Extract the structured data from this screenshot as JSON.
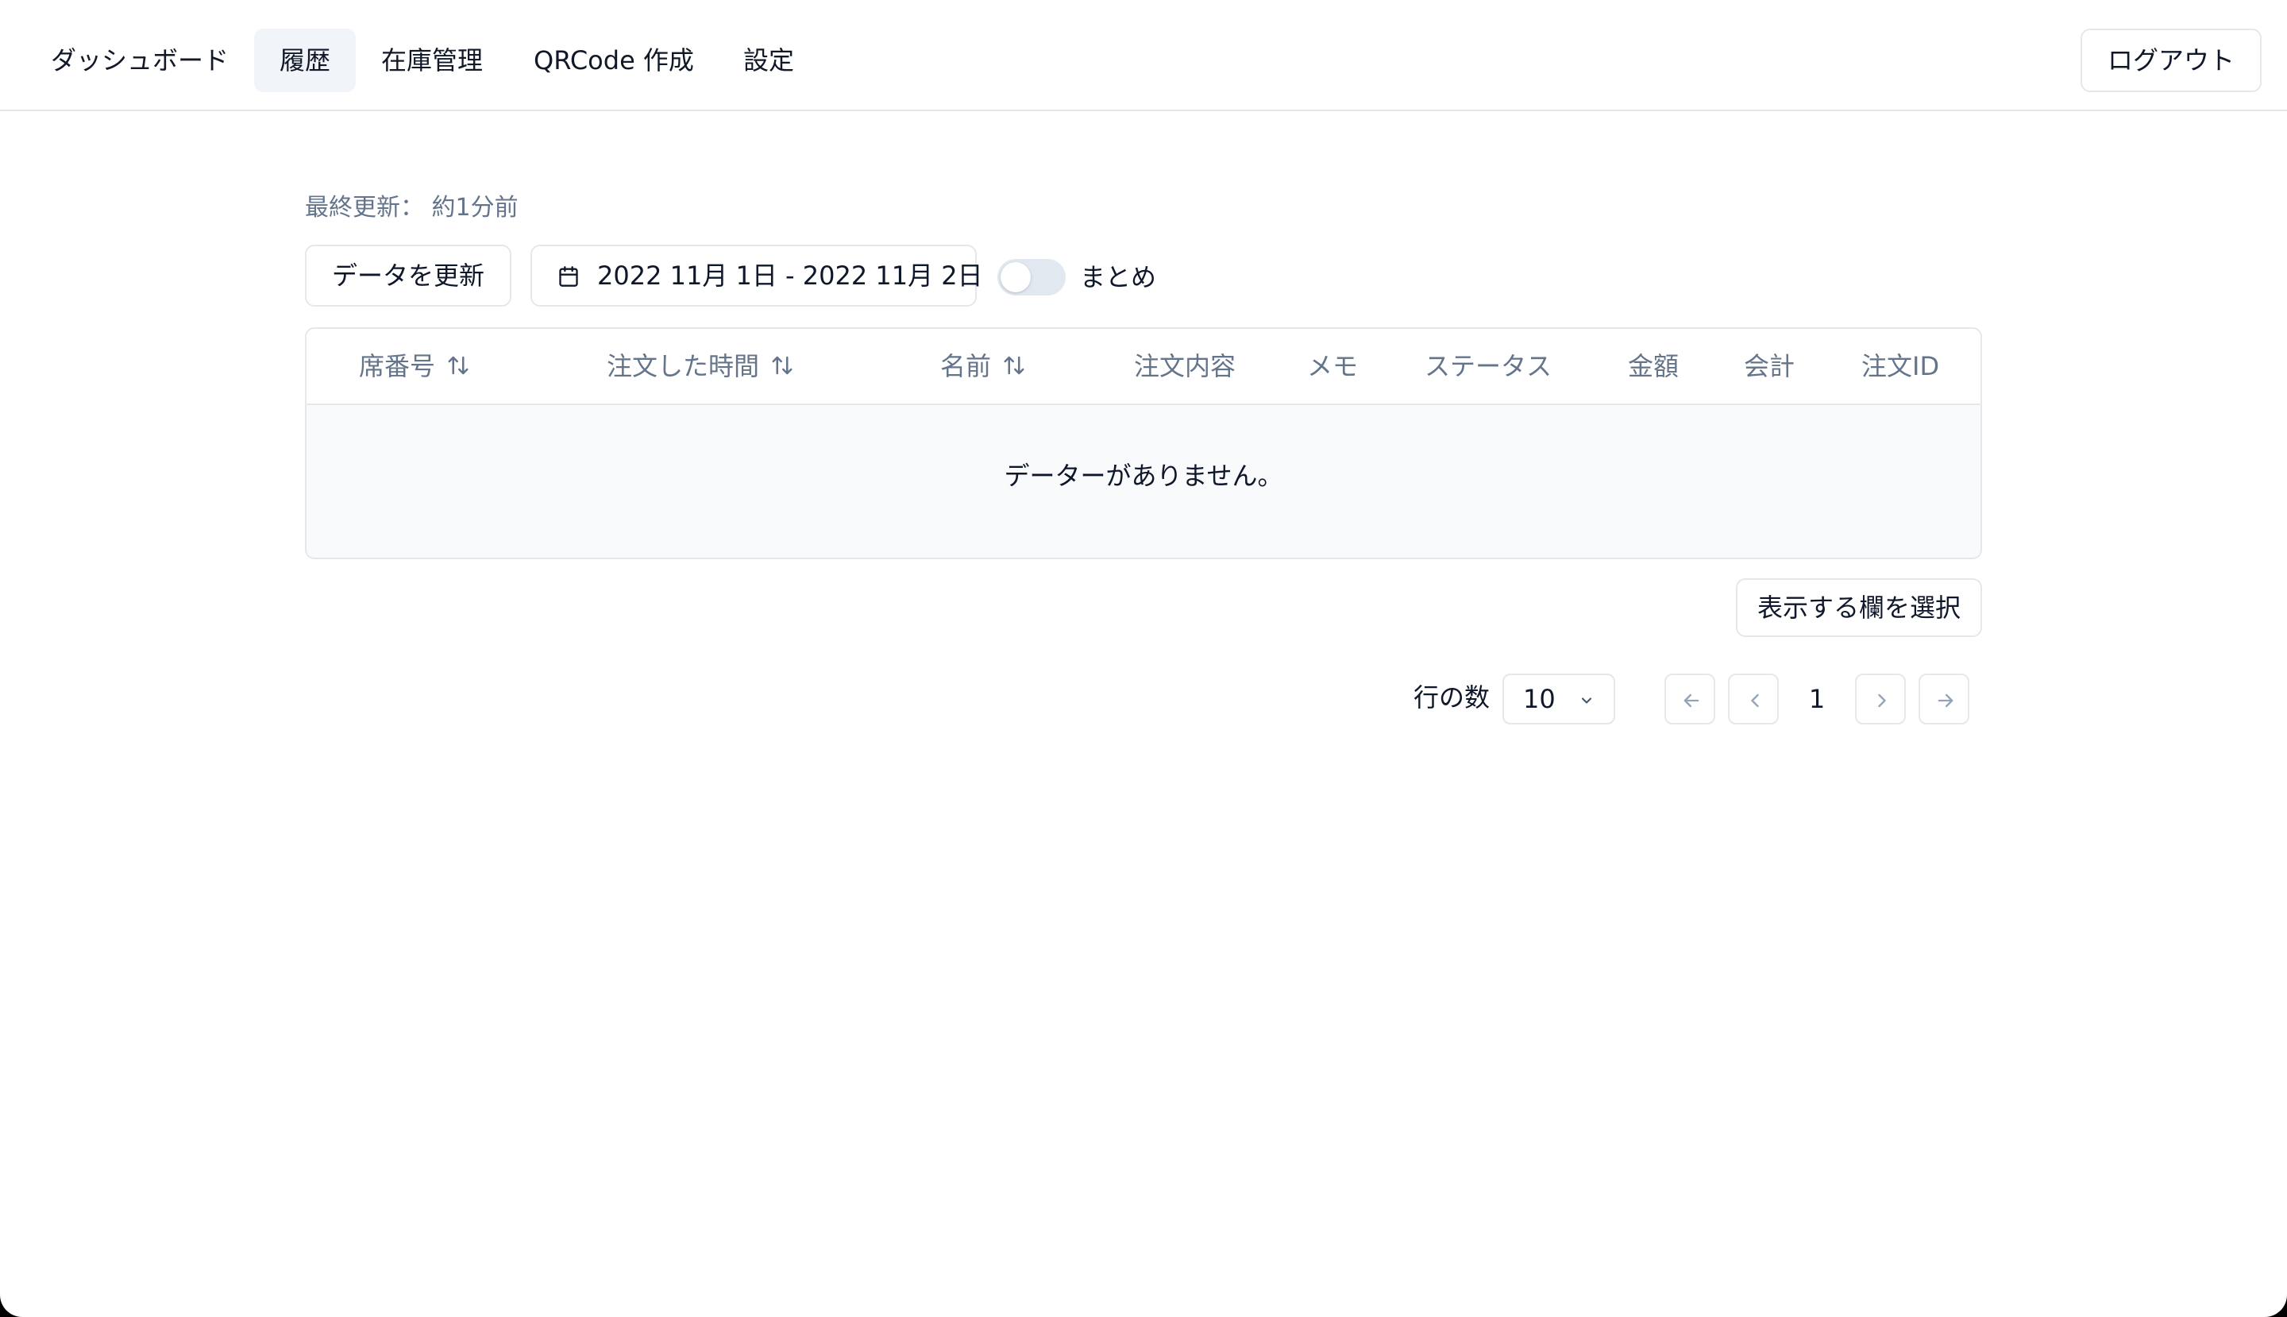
{
  "nav": {
    "items": [
      {
        "label": "ダッシュボード"
      },
      {
        "label": "履歴"
      },
      {
        "label": "在庫管理"
      },
      {
        "label": "QRCode 作成"
      },
      {
        "label": "設定"
      }
    ],
    "active": "履歴",
    "logout_label": "ログアウト"
  },
  "toolbar": {
    "last_updated": "最終更新： 約1分前",
    "refresh_label": "データを更新",
    "date_range": "2022 11月 1日 - 2022 11月 2日",
    "toggle_label": "まとめ",
    "toggle_on": false
  },
  "table": {
    "columns": [
      {
        "label": "席番号",
        "sortable": true
      },
      {
        "label": "注文した時間",
        "sortable": true
      },
      {
        "label": "名前",
        "sortable": true
      },
      {
        "label": "注文内容",
        "sortable": false
      },
      {
        "label": "メモ",
        "sortable": false
      },
      {
        "label": "ステータス",
        "sortable": false
      },
      {
        "label": "金額",
        "sortable": false
      },
      {
        "label": "会計",
        "sortable": false
      },
      {
        "label": "注文ID",
        "sortable": false
      }
    ],
    "empty_message": "データーがありません。"
  },
  "columns_button_label": "表示する欄を選択",
  "pagination": {
    "rows_label": "行の数",
    "rows_per_page": "10",
    "current_page": "1"
  },
  "colors": {
    "muted_text": "#64748b",
    "border": "#e5e7eb",
    "active_nav_bg": "#f1f5f9",
    "empty_bg": "#f8fafc"
  }
}
